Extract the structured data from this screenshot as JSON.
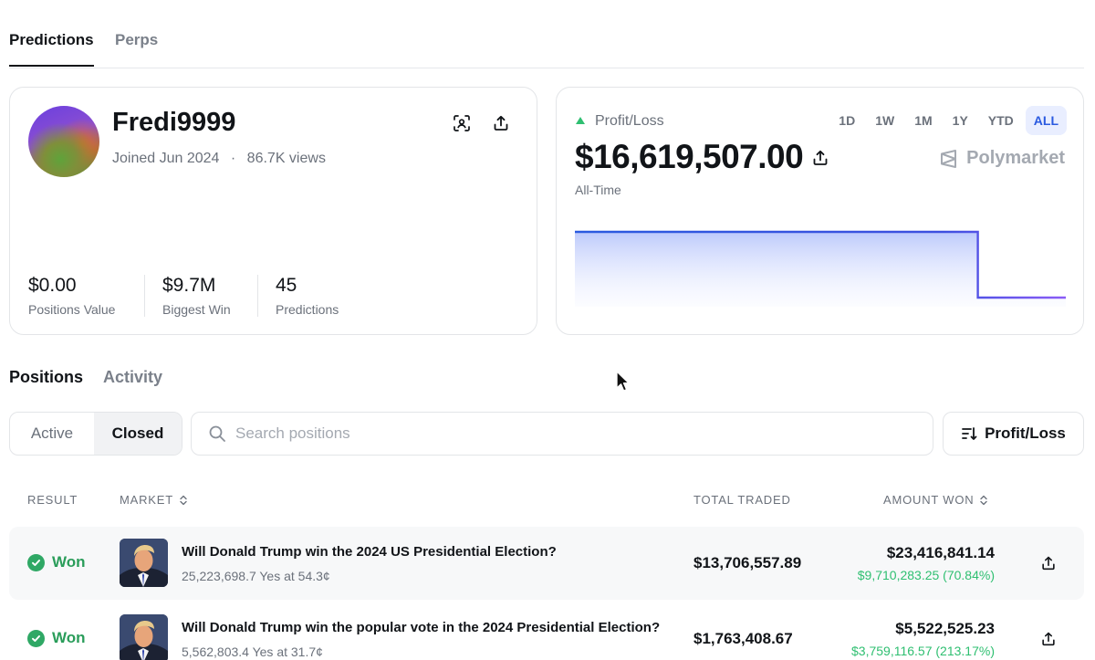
{
  "top_tabs": [
    {
      "label": "Predictions",
      "active": true
    },
    {
      "label": "Perps",
      "active": false
    }
  ],
  "profile": {
    "username": "Fredi9999",
    "joined": "Joined Jun 2024",
    "separator": "·",
    "views": "86.7K views",
    "icons": [
      "scan-icon",
      "share-icon"
    ],
    "stats": [
      {
        "value": "$0.00",
        "label": "Positions Value"
      },
      {
        "value": "$9.7M",
        "label": "Biggest Win"
      },
      {
        "value": "45",
        "label": "Predictions"
      }
    ]
  },
  "pnl": {
    "title": "Profit/Loss",
    "amount": "$16,619,507.00",
    "period": "All-Time",
    "brand": "Polymarket",
    "ranges": [
      "1D",
      "1W",
      "1M",
      "1Y",
      "YTD",
      "ALL"
    ],
    "active_range": "ALL",
    "colors": {
      "up": "#2fbf71",
      "line_start": "#2a5ae0",
      "line_end": "#8b5cf6"
    }
  },
  "chart_data": {
    "type": "area",
    "x": [
      0,
      1,
      2,
      3,
      4,
      5,
      6,
      7,
      8,
      9,
      10,
      11,
      12
    ],
    "values": [
      1,
      1,
      1,
      1,
      1,
      1,
      1,
      1,
      1,
      1,
      0,
      0,
      0
    ],
    "ylim": [
      0,
      1.25
    ],
    "title": "",
    "xlabel": "",
    "ylabel": "",
    "grid": false
  },
  "section_tabs": [
    {
      "label": "Positions",
      "active": true
    },
    {
      "label": "Activity",
      "active": false
    }
  ],
  "filter": {
    "active_label": "Active",
    "closed_label": "Closed",
    "selected": "Closed",
    "search_placeholder": "Search positions",
    "sort_label": "Profit/Loss"
  },
  "table": {
    "headers": {
      "result": "RESULT",
      "market": "MARKET",
      "total_traded": "TOTAL TRADED",
      "amount_won": "AMOUNT WON"
    },
    "rows": [
      {
        "result": "Won",
        "title": "Will Donald Trump win the 2024 US Presidential Election?",
        "sub": "25,223,698.7 Yes at 54.3¢",
        "traded": "$13,706,557.89",
        "won": "$23,416,841.14",
        "won_pct": "$9,710,283.25 (70.84%)"
      },
      {
        "result": "Won",
        "title": "Will Donald Trump win the popular vote in the 2024 Presidential Election?",
        "sub": "5,562,803.4 Yes at 31.7¢",
        "traded": "$1,763,408.67",
        "won": "$5,522,525.23",
        "won_pct": "$3,759,116.57 (213.17%)"
      }
    ]
  }
}
